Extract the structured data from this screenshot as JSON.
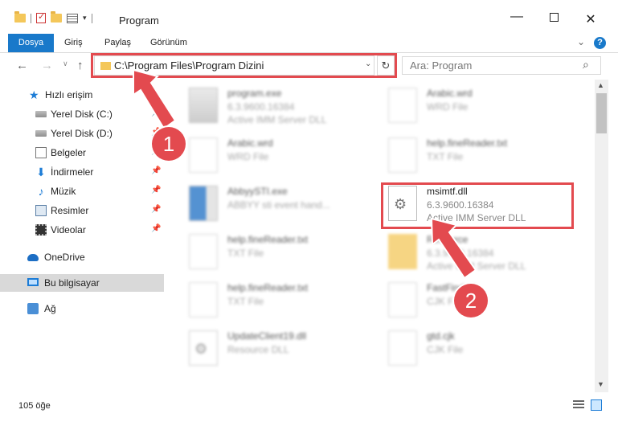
{
  "window": {
    "title": "Program",
    "minimize_glyph": "—",
    "close_glyph": "✕"
  },
  "ribbon": {
    "tabs": [
      "Dosya",
      "Giriş",
      "Paylaş",
      "Görünüm"
    ],
    "help_glyph": "?"
  },
  "address": {
    "path": "C:\\Program Files\\Program Dizini",
    "search_placeholder": "Ara: Program"
  },
  "nav": {
    "items": [
      {
        "label": "Hızlı erişim",
        "icon": "star-icon"
      },
      {
        "label": "Yerel Disk (C:)",
        "icon": "drive-icon",
        "pinned": true
      },
      {
        "label": "Yerel Disk (D:)",
        "icon": "drive-icon",
        "pinned": true
      },
      {
        "label": "Belgeler",
        "icon": "documents-icon",
        "pinned": true
      },
      {
        "label": "İndirmeler",
        "icon": "download-icon",
        "pinned": true
      },
      {
        "label": "Müzik",
        "icon": "music-icon",
        "pinned": true
      },
      {
        "label": "Resimler",
        "icon": "pictures-icon",
        "pinned": true
      },
      {
        "label": "Videolar",
        "icon": "videos-icon",
        "pinned": true
      },
      {
        "label": "OneDrive",
        "icon": "cloud-icon"
      },
      {
        "label": "Bu bilgisayar",
        "icon": "computer-icon",
        "selected": true
      },
      {
        "label": "Ağ",
        "icon": "network-icon"
      }
    ]
  },
  "files": [
    {
      "name": "program.exe",
      "line1": "6.3.9600.16384",
      "line2": "Active IMM Server DLL"
    },
    {
      "name": "Arabic.wrd",
      "line1": "WRD File",
      "line2": ""
    },
    {
      "name": "Arabic.wrd",
      "line1": "WRD File",
      "line2": ""
    },
    {
      "name": "help.fineReader.txt",
      "line1": "TXT File",
      "line2": ""
    },
    {
      "name": "AbbyySTI.exe",
      "line1": "ABBYY sti event hand...",
      "line2": ""
    },
    {
      "name": "msimtf.dll",
      "line1": "6.3.9600.16384",
      "line2": "Active IMM Server DLL"
    },
    {
      "name": "help.fineReader.txt",
      "line1": "TXT File",
      "line2": ""
    },
    {
      "name": "Resource",
      "line1": "6.3.9600.16384",
      "line2": "Active IMM Server DLL"
    },
    {
      "name": "help.fineReader.txt",
      "line1": "TXT File",
      "line2": ""
    },
    {
      "name": "FastFind.cjk",
      "line1": "CJK File",
      "line2": ""
    },
    {
      "name": "UpdateClient19.dll",
      "line1": "Resource DLL",
      "line2": ""
    },
    {
      "name": "gtd.cjk",
      "line1": "CJK File",
      "line2": ""
    }
  ],
  "status": {
    "count": "105 öğe"
  },
  "annotations": {
    "badge1": "1",
    "badge2": "2",
    "highlight_color": "#e34a4f"
  },
  "colors": {
    "accent": "#1979ca",
    "annotation": "#e34a4f"
  }
}
